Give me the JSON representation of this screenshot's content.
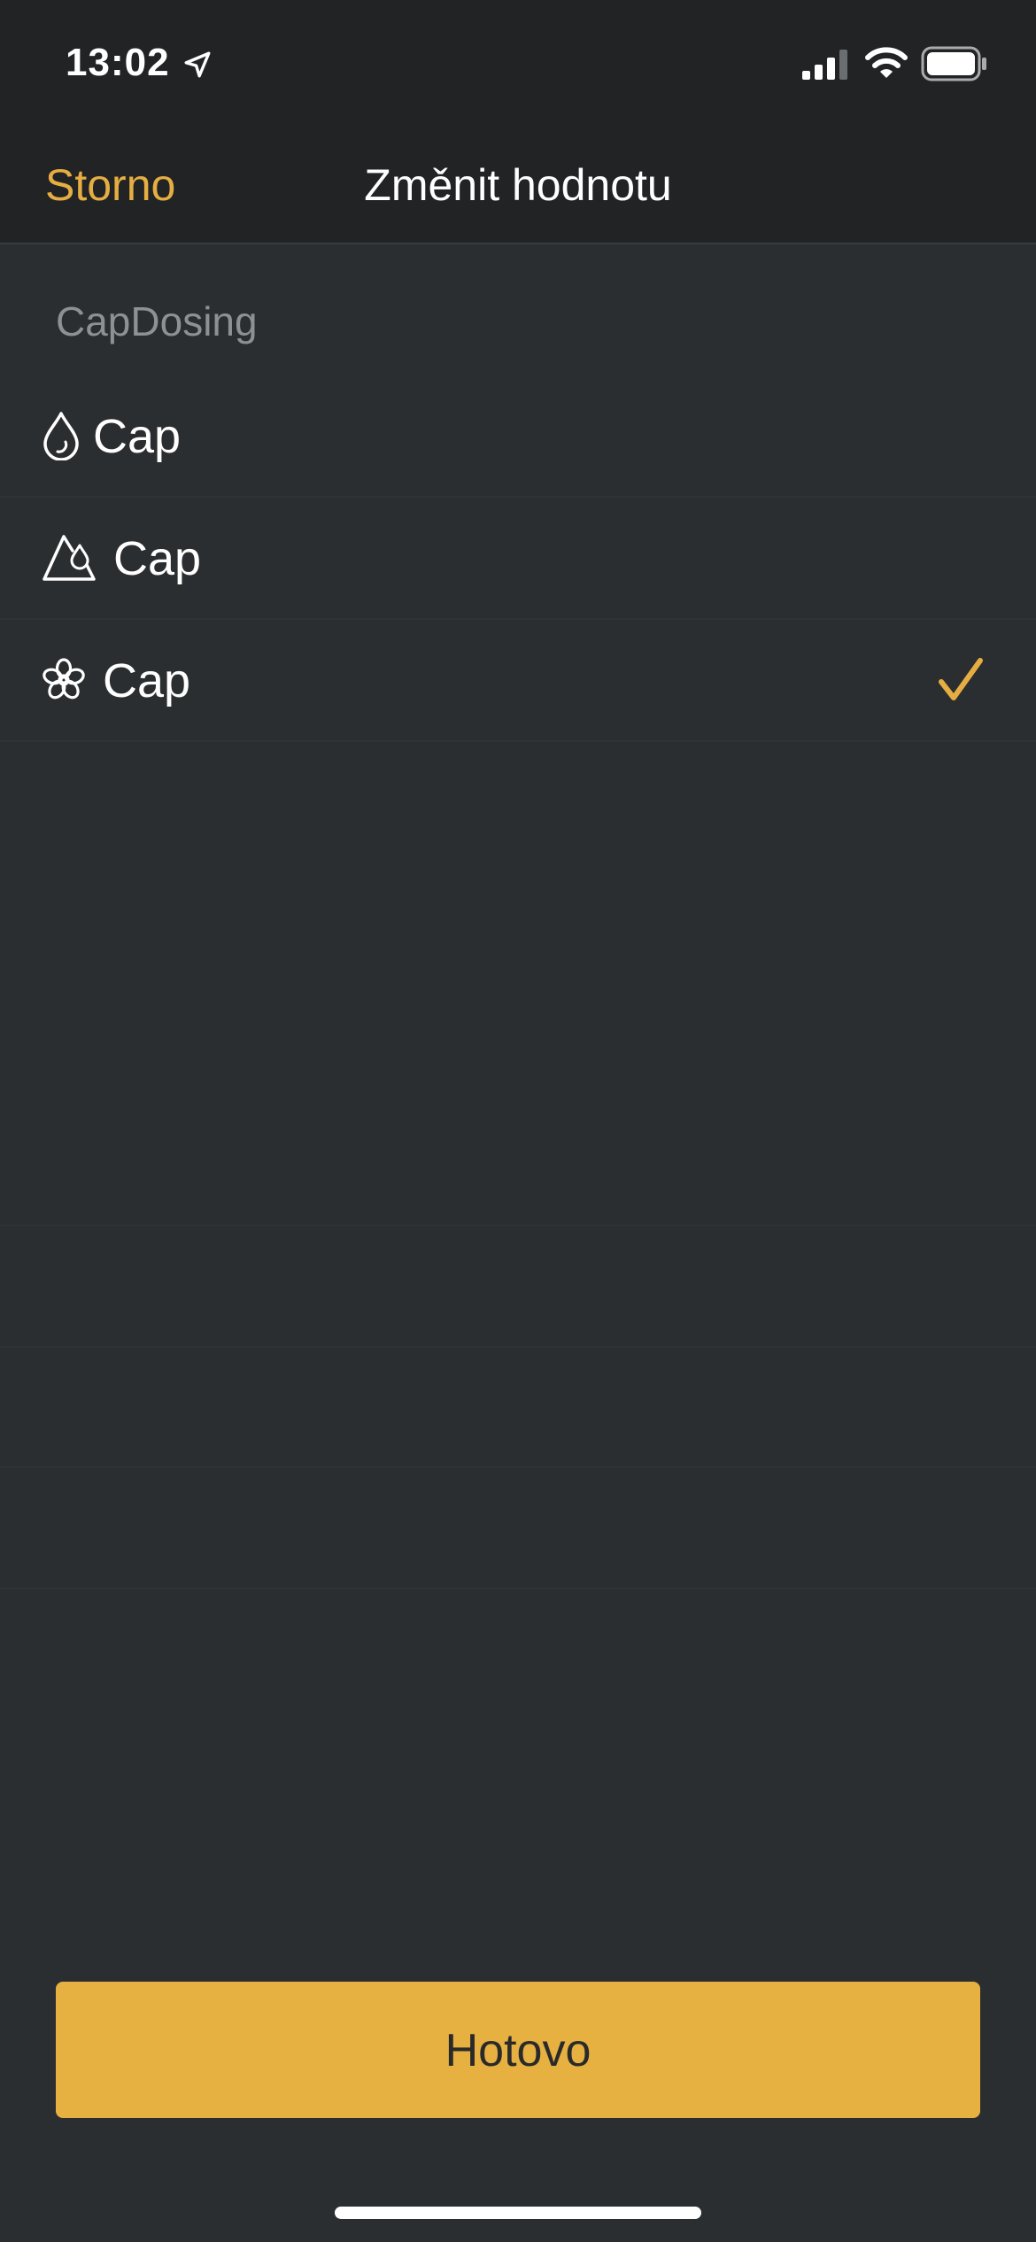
{
  "status_bar": {
    "time": "13:02",
    "icons": [
      "location-arrow-icon",
      "cellular-signal-icon",
      "wifi-icon",
      "battery-icon"
    ]
  },
  "nav": {
    "cancel_label": "Storno",
    "title": "Změnit hodnotu"
  },
  "section": {
    "header": "CapDosing",
    "options": [
      {
        "label": "Cap",
        "icon": "droplet-icon",
        "selected": false
      },
      {
        "label": "Cap",
        "icon": "mountain-droplet-icon",
        "selected": false
      },
      {
        "label": "Cap",
        "icon": "flower-icon",
        "selected": true
      }
    ]
  },
  "footer": {
    "done_label": "Hotovo"
  },
  "colors": {
    "accent": "#e6ae42",
    "background": "#2b2e30",
    "bar_background": "#222325",
    "section_header": "#8e9194"
  }
}
